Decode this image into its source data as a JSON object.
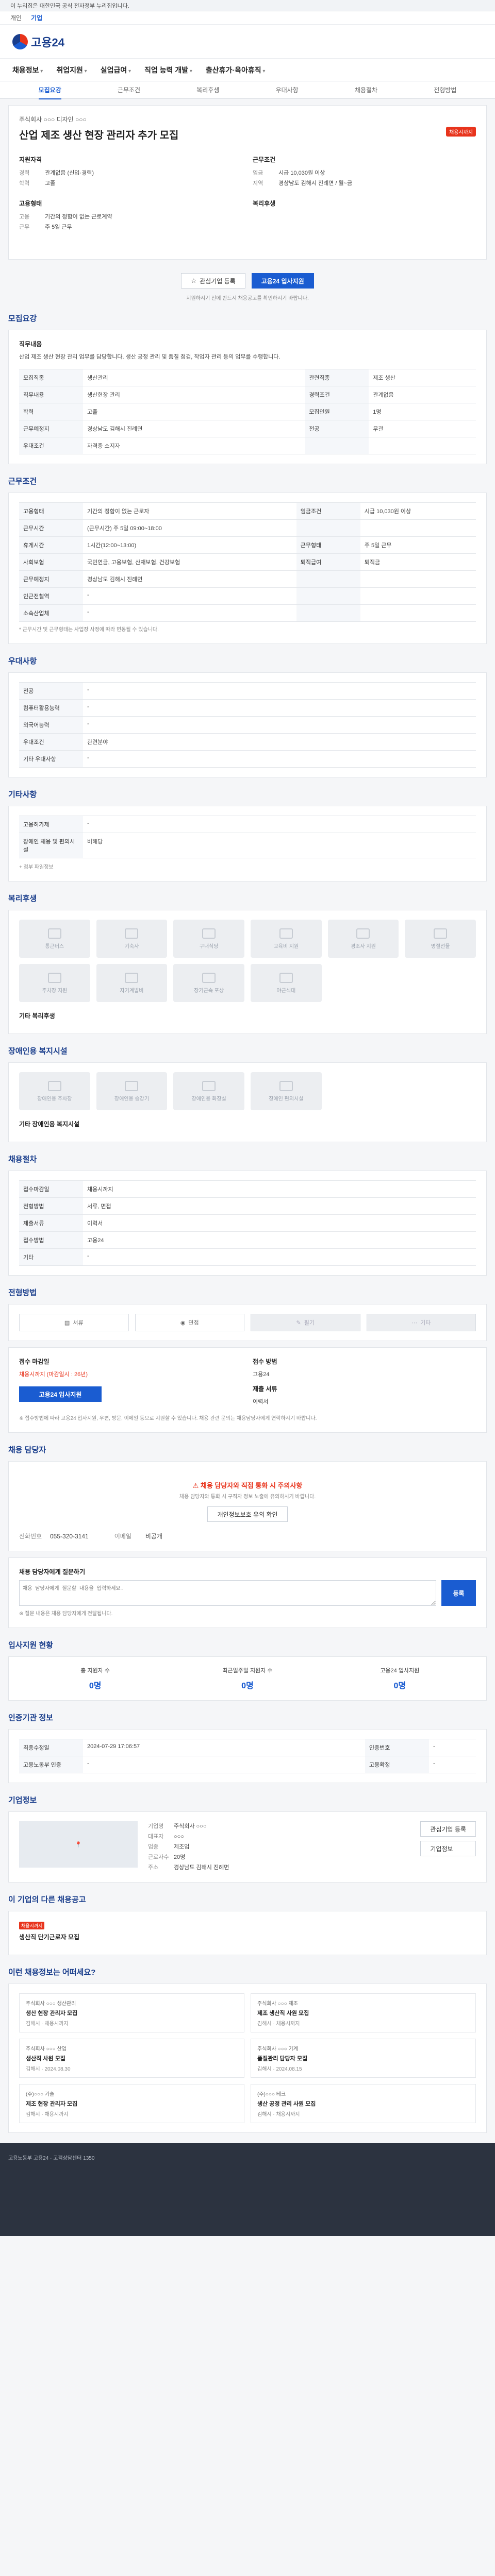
{
  "gov_banner": "이 누리집은 대한민국 공식 전자정부 누리집입니다.",
  "top_links": [
    "개인",
    "기업"
  ],
  "logo_text": "고용24",
  "gnb": [
    "채용정보",
    "취업지원",
    "실업급여",
    "직업 능력 개발",
    "출산휴가·육아휴직"
  ],
  "subtabs": [
    "모집요강",
    "근무조건",
    "복리후생",
    "우대사항",
    "채용절차",
    "전형방법"
  ],
  "job": {
    "company": "주식회사 ○○○ 디자인 ○○○",
    "title": "산업 제조 생산 현장 관리자 추가 모집",
    "badge": "채용시까지",
    "left_head": "지원자격",
    "left_rows": [
      {
        "k": "경력",
        "v": "관계없음 (신입·경력)"
      },
      {
        "k": "학력",
        "v": "고졸"
      }
    ],
    "right_head": "근무조건",
    "right_rows": [
      {
        "k": "임금",
        "v": "시급 10,030원 이상"
      },
      {
        "k": "지역",
        "v": "경상남도 김해시 진례면 / 월~금"
      }
    ],
    "left2_head": "고용형태",
    "left2_rows": [
      {
        "k": "고용",
        "v": "기간의 정함이 없는 근로계약"
      },
      {
        "k": "근무",
        "v": "주 5일 근무"
      }
    ],
    "right2_head": "복리후생",
    "btn_interest": "관심기업 등록",
    "btn_apply": "고용24 입사지원",
    "note": "지원하시기 전에 반드시 채용공고를 확인하시기 바랍니다."
  },
  "sec_recruit": "모집요강",
  "recruit_desc_head": "직무내용",
  "recruit_desc": "산업 제조 생산 현장 관리 업무를 담당합니다. 생산 공정 관리 및 품질 점검, 작업자 관리 등의 업무를 수행합니다.",
  "recruit_table": [
    [
      "모집직종",
      "생산관리",
      "관련직종",
      "제조 생산"
    ],
    [
      "직무내용",
      "생산현장 관리",
      "경력조건",
      "관계없음"
    ],
    [
      "학력",
      "고졸",
      "모집인원",
      "1명"
    ],
    [
      "근무예정지",
      "경상남도 김해시 진례면",
      "전공",
      "무관"
    ],
    [
      "우대조건",
      "자격증 소지자",
      "",
      ""
    ]
  ],
  "sec_work": "근무조건",
  "work_table": [
    [
      "고용형태",
      "기간의 정함이 없는 근로자",
      "임금조건",
      "시급 10,030원 이상"
    ],
    [
      "근무시간",
      "(근무시간) 주 5일 09:00~18:00",
      "",
      ""
    ],
    [
      "휴게시간",
      "1시간(12:00~13:00)",
      "근무형태",
      "주 5일 근무"
    ],
    [
      "사회보험",
      "국민연금, 고용보험, 산재보험, 건강보험",
      "퇴직급여",
      "퇴직금"
    ],
    [
      "근무예정지",
      "경상남도 김해시 진례면",
      "",
      ""
    ],
    [
      "인근전철역",
      "-",
      "",
      ""
    ],
    [
      "소속산업체",
      "-",
      "",
      ""
    ]
  ],
  "work_note": "* 근무시간 및 근무형태는 사업장 사정에 따라 변동될 수 있습니다.",
  "sec_pref": "우대사항",
  "pref_table": [
    [
      "전공",
      "-"
    ],
    [
      "컴퓨터활용능력",
      "-"
    ],
    [
      "외국어능력",
      "-"
    ],
    [
      "우대조건",
      "관련분야"
    ],
    [
      "기타 우대사항",
      "-"
    ]
  ],
  "sec_etc": "기타사항",
  "etc_table": [
    [
      "고용허가제",
      "-"
    ],
    [
      "장애인 채용 및 편의시설",
      "비해당"
    ]
  ],
  "etc_more": "+ 첨부 파일정보",
  "sec_welfare": "복리후생",
  "welfare_tiles": [
    "통근버스",
    "기숙사",
    "구내식당",
    "교육비 지원",
    "경조사 지원",
    "명절선물",
    "주차장 지원",
    "자기계발비",
    "장기근속 포상",
    "야근식대"
  ],
  "welfare_etc": "기타 복리후생",
  "sec_disability": "장애인용 복지시설",
  "disability_tiles": [
    "장애인용 주차장",
    "장애인용 승강기",
    "장애인용 화장실",
    "장애인 편의시설"
  ],
  "disability_etc": "기타 장애인용 복지시설",
  "sec_process": "채용절차",
  "process_table": [
    [
      "접수마감일",
      "채용시까지"
    ],
    [
      "전형방법",
      "서류, 면접"
    ],
    [
      "제출서류",
      "이력서"
    ],
    [
      "접수방법",
      "고용24"
    ],
    [
      "기타",
      "-"
    ]
  ],
  "sec_method": "전형방법",
  "methods": [
    "서류",
    "면접",
    "필기",
    "기타"
  ],
  "apply_left_head": "접수 마감일",
  "apply_left_val": "채용시까지 (마감일시 : 26년)",
  "apply_btn": "고용24 입사지원",
  "apply_right_head": "접수 방법",
  "apply_right_val": "고용24",
  "apply_right_head2": "제출 서류",
  "apply_right_val2": "이력서",
  "apply_notes": "※ 접수방법에 따라 고용24 입사지원, 우편, 방문, 이메일 등으로 지원할 수 있습니다. 채용 관련 문의는 채용담당자에게 연락하시기 바랍니다.",
  "sec_contact": "채용 담당자",
  "contact_warn": "채용 담당자와 직접 통화 시 주의사항",
  "contact_warn_desc": "채용 담당자와 통화 시 구직자 정보 노출에 유의하시기 바랍니다.",
  "contact_btn": "개인정보보호 유의 확인",
  "contact_phone_label": "전화번호",
  "contact_phone": "055-320-3141",
  "contact_email_label": "이메일",
  "contact_email": "비공개",
  "sec_question": "채용 담당자에게 질문하기",
  "question_placeholder": "채용 담당자에게 질문할 내용을 입력하세요.",
  "question_btn": "등록",
  "question_notes": "※ 질문 내용은 채용 담당자에게 전달됩니다.",
  "sec_status": "입사지원 현황",
  "status_cols": [
    {
      "label": "총 지원자 수",
      "val": "0명"
    },
    {
      "label": "최근일주일 지원자 수",
      "val": "0명"
    },
    {
      "label": "고용24 입사지원",
      "val": "0명"
    }
  ],
  "sec_info": "인증기관 정보",
  "info_table": [
    [
      "최종수정일",
      "2024-07-29 17:06:57",
      "인증번호",
      "-"
    ],
    [
      "고용노동부 인증",
      "-",
      "고용확정",
      "-"
    ]
  ],
  "sec_company": "기업정보",
  "company_fields": [
    [
      "기업명",
      "주식회사 ○○○"
    ],
    [
      "대표자",
      "○○○"
    ],
    [
      "업종",
      "제조업"
    ],
    [
      "근로자수",
      "20명"
    ],
    [
      "주소",
      "경상남도 김해시 진례면"
    ]
  ],
  "company_btns": [
    "관심기업 등록",
    "기업정보"
  ],
  "sec_similar": "이 기업의 다른 채용공고",
  "similar_title": "생산직 단기근로자 모집",
  "similar_tag": "채용시까지",
  "sec_recommend": "이런 채용정보는 어떠세요?",
  "recs": [
    {
      "co": "주식회사 ○○○ 생산관리",
      "tt": "생산 현장 관리자 모집",
      "meta": "김해시 · 채용시까지"
    },
    {
      "co": "주식회사 ○○○ 제조",
      "tt": "제조 생산직 사원 모집",
      "meta": "김해시 · 채용시까지"
    },
    {
      "co": "주식회사 ○○○ 산업",
      "tt": "생산직 사원 모집",
      "meta": "김해시 · 2024.08.30"
    },
    {
      "co": "주식회사 ○○○ 기계",
      "tt": "품질관리 담당자 모집",
      "meta": "김해시 · 2024.08.15"
    },
    {
      "co": "(주)○○○ 기술",
      "tt": "제조 현장 관리자 모집",
      "meta": "김해시 · 채용시까지"
    },
    {
      "co": "(주)○○○ 테크",
      "tt": "생산 공정 관리 사원 모집",
      "meta": "김해시 · 채용시까지"
    }
  ],
  "footer": "고용노동부 고용24 · 고객상담센터 1350"
}
